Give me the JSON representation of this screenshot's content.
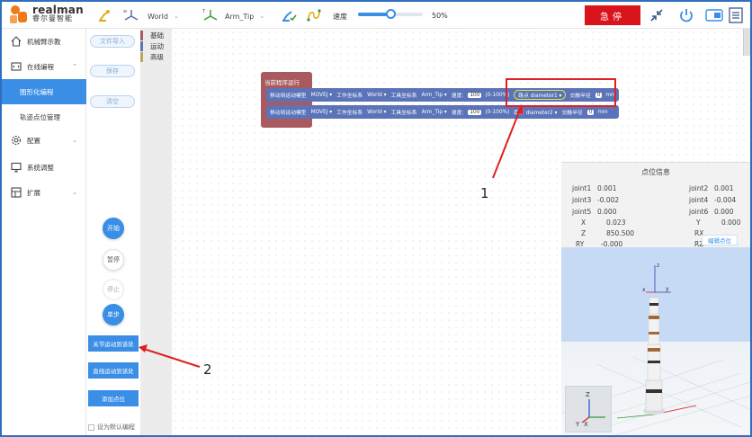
{
  "brand": {
    "name_en": "realman",
    "name_cn": "睿尔曼智能"
  },
  "toolbar": {
    "frame1_label": "World",
    "frame2_label": "Arm_Tip",
    "speed_label": "速度",
    "speed_value": "50%",
    "speed_percent": 50,
    "estop_label": "急停"
  },
  "sidebar": {
    "items": [
      {
        "label": "机械臂示教"
      },
      {
        "label": "在线编程"
      },
      {
        "label": "图形化编程"
      },
      {
        "label": "轨迹点位管理"
      },
      {
        "label": "配置"
      },
      {
        "label": "系统调整"
      },
      {
        "label": "扩展"
      }
    ]
  },
  "buttons": {
    "import": "文件导入",
    "save": "保存",
    "clear": "清空",
    "start": "开始",
    "pause": "暂停",
    "stop": "停止",
    "step": "单步",
    "joint_pos": "关节运动到该处",
    "linear_pos": "直线运动到该处",
    "save_point": "添加点位",
    "default_check": "设为默认编程"
  },
  "categories": [
    {
      "label": "基础",
      "color": "#a85a5e"
    },
    {
      "label": "运动",
      "color": "#5b73b8"
    },
    {
      "label": "高级",
      "color": "#b8a85a"
    }
  ],
  "blocks": {
    "header": "当前程序运行",
    "rows": [
      {
        "cmd": "移动到运动模型",
        "type": "MOVEJ",
        "frame_label": "工作坐标系",
        "frame": "World",
        "tool_label": "工具坐标系",
        "tool": "Arm_Tip",
        "speed_label": "速度:",
        "speed": "100",
        "range": "(0-100%)",
        "point_label": "路点",
        "point": "diameter1",
        "r_label": "交融半径",
        "r": "0",
        "unit": "mm"
      },
      {
        "cmd": "移动到运动模型",
        "type": "MOVEJ",
        "frame_label": "工作坐标系",
        "frame": "World",
        "tool_label": "工具坐标系",
        "tool": "Arm_Tip",
        "speed_label": "速度:",
        "speed": "100",
        "range": "(0-100%)",
        "point_label": "路点",
        "point": "diameter2",
        "r_label": "交融半径",
        "r": "0",
        "unit": "mm"
      }
    ]
  },
  "annotations": {
    "a1": "1",
    "a2": "2"
  },
  "point_info": {
    "title": "点位信息",
    "rows": [
      {
        "k1": "joint1",
        "v1": "0.001",
        "k2": "joint2",
        "v2": "0.001"
      },
      {
        "k1": "joint3",
        "v1": "-0.002",
        "k2": "joint4",
        "v2": "-0.004"
      },
      {
        "k1": "joint5",
        "v1": "0.000",
        "k2": "joint6",
        "v2": "0.000"
      },
      {
        "k1": "X",
        "v1": "0.023",
        "k2": "Y",
        "v2": "0.000"
      },
      {
        "k1": "Z",
        "v1": "850.500",
        "k2": "RX",
        "v2": ""
      },
      {
        "k1": "RY",
        "v1": "-0.000",
        "k2": "RZ",
        "v2": ""
      }
    ],
    "edit_label": "编辑点位"
  },
  "viewer": {
    "axis_x": "x",
    "axis_y": "y",
    "axis_z": "z",
    "cube_x": "X",
    "cube_y": "Y",
    "cube_z": "Z"
  },
  "colors": {
    "accent": "#3a8ee6",
    "estop": "#d9141b",
    "block_head": "#a85a5e",
    "block_row": "#5b73b8",
    "highlight": "#e02020"
  }
}
